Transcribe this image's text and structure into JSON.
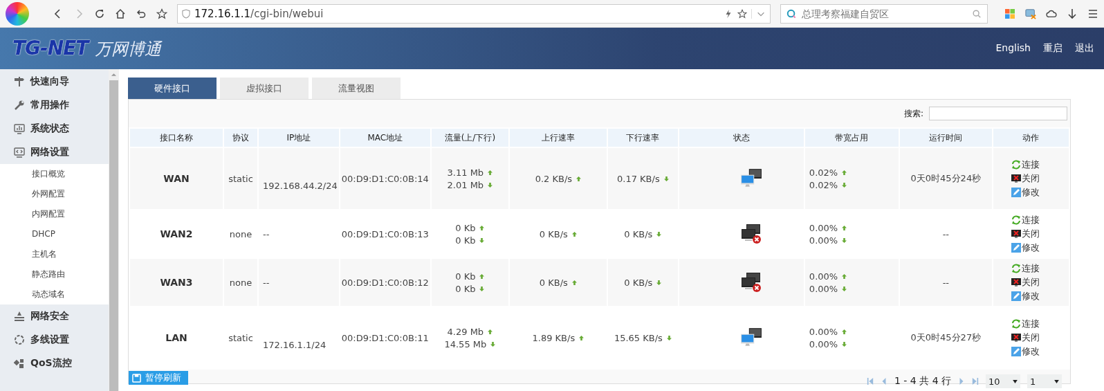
{
  "browser": {
    "url_host": "172.16.1.1",
    "url_path": "/cgi-bin/webui",
    "search_placeholder": "总理考察福建自贸区"
  },
  "header": {
    "logo_latin": "TG-NET",
    "logo_cjk": "万网博通",
    "links": [
      "English",
      "重启",
      "退出"
    ]
  },
  "sidebar": {
    "items": [
      {
        "label": "快速向导"
      },
      {
        "label": "常用操作"
      },
      {
        "label": "系统状态"
      },
      {
        "label": "网络设置",
        "children": [
          {
            "label": "接口概览"
          },
          {
            "label": "外网配置"
          },
          {
            "label": "内网配置"
          },
          {
            "label": "DHCP"
          },
          {
            "label": "主机名"
          },
          {
            "label": "静态路由"
          },
          {
            "label": "动态域名"
          }
        ]
      },
      {
        "label": "网络安全"
      },
      {
        "label": "多线设置"
      },
      {
        "label": "QoS流控"
      }
    ]
  },
  "tabs": [
    {
      "label": "硬件接口",
      "selected": true
    },
    {
      "label": "虚拟接口",
      "selected": false
    },
    {
      "label": "流量视图",
      "selected": false
    }
  ],
  "search": {
    "label": "搜索:"
  },
  "table": {
    "columns": [
      "接口名称",
      "协议",
      "IP地址",
      "MAC地址",
      "流量(上/下行)",
      "上行速率",
      "下行速率",
      "状态",
      "带宽占用",
      "运行时间",
      "动作"
    ],
    "rows": [
      {
        "name": "WAN",
        "protocol": "static",
        "ip": "192.168.44.2/24",
        "mac": "00:D9:D1:C0:0B:14",
        "traffic_up": "3.11 Mb",
        "traffic_down": "2.01 Mb",
        "up_rate": "0.2 KB/s",
        "down_rate": "0.17 KB/s",
        "connected": true,
        "bw_up": "0.02%",
        "bw_down": "0.02%",
        "uptime": "0天0时45分24秒",
        "actions": [
          "连接",
          "关闭",
          "修改"
        ]
      },
      {
        "name": "WAN2",
        "protocol": "none",
        "ip": "--",
        "mac": "00:D9:D1:C0:0B:13",
        "traffic_up": "0 Kb",
        "traffic_down": "0 Kb",
        "up_rate": "0 KB/s",
        "down_rate": "0 KB/s",
        "connected": false,
        "bw_up": "0.00%",
        "bw_down": "0.00%",
        "uptime": "--",
        "actions": [
          "连接",
          "关闭",
          "修改"
        ]
      },
      {
        "name": "WAN3",
        "protocol": "none",
        "ip": "--",
        "mac": "00:D9:D1:C0:0B:12",
        "traffic_up": "0 Kb",
        "traffic_down": "0 Kb",
        "up_rate": "0 KB/s",
        "down_rate": "0 KB/s",
        "connected": false,
        "bw_up": "0.00%",
        "bw_down": "0.00%",
        "uptime": "--",
        "actions": [
          "连接",
          "关闭",
          "修改"
        ]
      },
      {
        "name": "LAN",
        "protocol": "static",
        "ip": "172.16.1.1/24",
        "mac": "00:D9:D1:C0:0B:11",
        "traffic_up": "4.29 Mb",
        "traffic_down": "14.55 Mb",
        "up_rate": "1.89 KB/s",
        "down_rate": "15.65 KB/s",
        "connected": true,
        "bw_up": "0.00%",
        "bw_down": "0.00%",
        "uptime": "0天0时45分27秒",
        "actions": [
          "连接",
          "关闭",
          "修改"
        ]
      }
    ]
  },
  "pause_button": "暂停刷新",
  "pagination": {
    "summary": "1 - 4 共 4 行",
    "page_size": "10",
    "page": "1"
  }
}
